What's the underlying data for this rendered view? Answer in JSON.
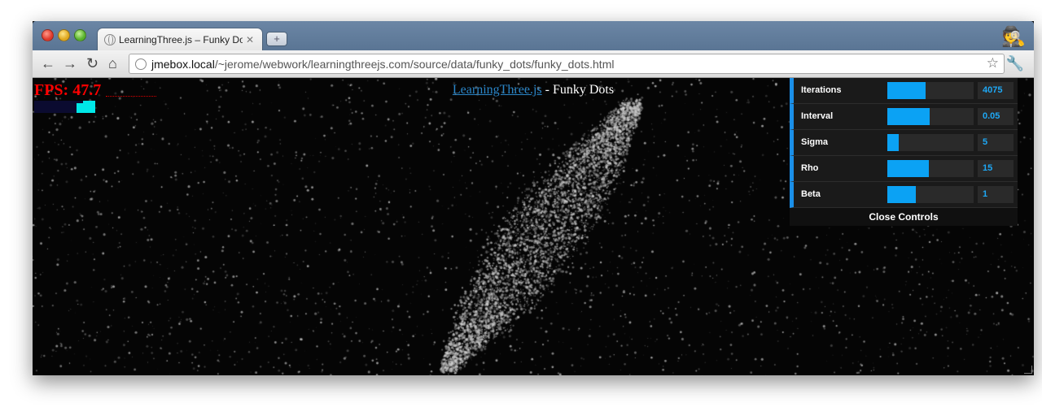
{
  "browser": {
    "tab_title": "LearningThree.js – Funky Dots",
    "tab_close": "✕",
    "new_tab": "+",
    "url_host": "jmebox.local",
    "url_path": "/~jerome/webwork/learningthreejs.com/source/data/funky_dots/funky_dots.html",
    "nav": {
      "back": "←",
      "forward": "→",
      "reload": "↻",
      "home": "⌂",
      "star": "☆",
      "wrench": "🔧",
      "incognito": "🕵"
    },
    "icons": [
      "back-arrow-icon",
      "forward-arrow-icon",
      "reload-icon",
      "home-icon",
      "globe-icon",
      "star-icon",
      "wrench-icon",
      "incognito-icon"
    ]
  },
  "page": {
    "heading_link": "LearningThree.js",
    "heading_rest": " - Funky Dots",
    "fps_text": "FPS:  47.7"
  },
  "gui": {
    "accent_color": "#0ba2f4",
    "controls": [
      {
        "label": "Iterations",
        "value": "4075",
        "fill": 0.44
      },
      {
        "label": "Interval",
        "value": "0.05",
        "fill": 0.49
      },
      {
        "label": "Sigma",
        "value": "5",
        "fill": 0.13
      },
      {
        "label": "Rho",
        "value": "15",
        "fill": 0.48
      },
      {
        "label": "Beta",
        "value": "1",
        "fill": 0.33
      }
    ],
    "close_label": "Close Controls"
  }
}
